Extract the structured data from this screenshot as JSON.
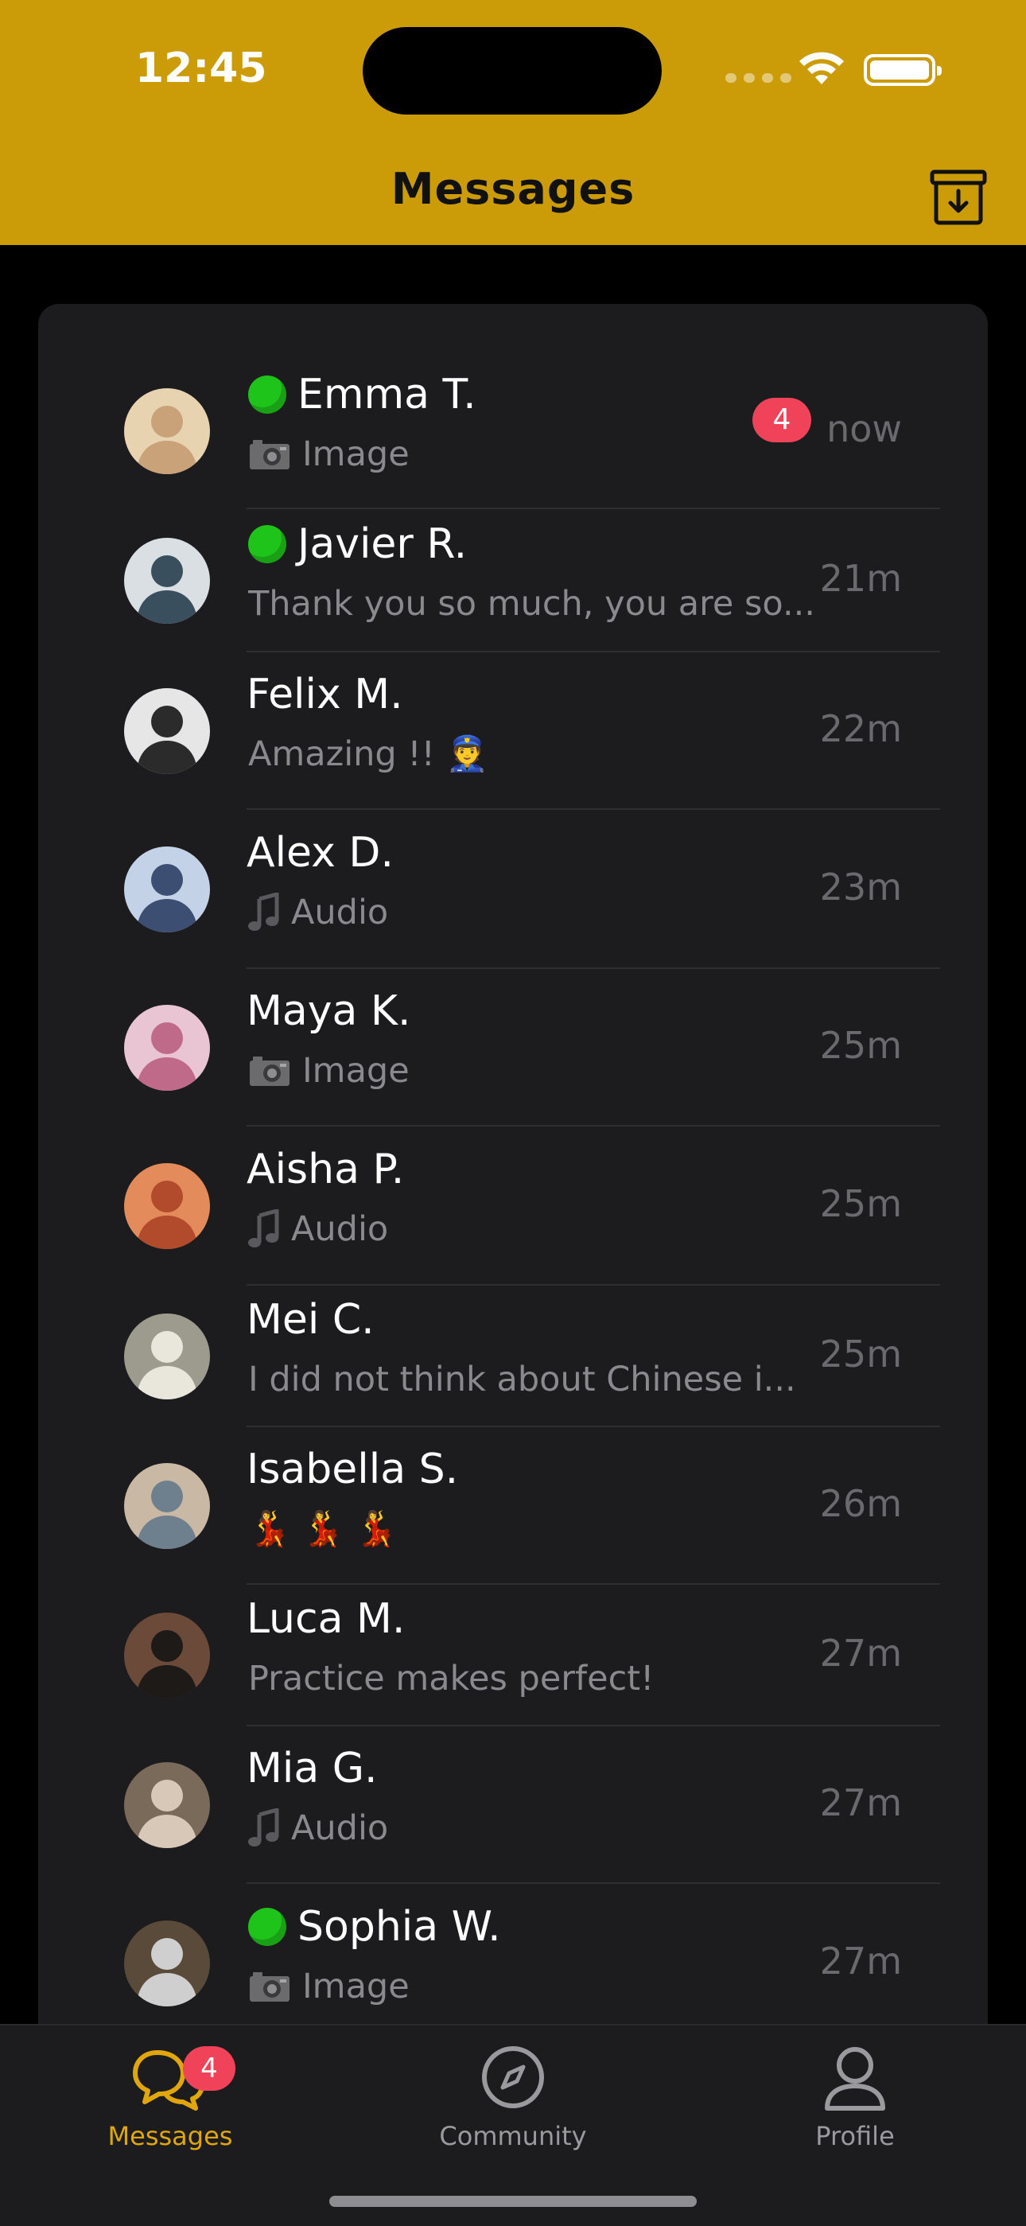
{
  "status_bar": {
    "time": "12:45"
  },
  "header": {
    "title": "Messages",
    "archive_icon": "archive-icon"
  },
  "colors": {
    "accent": "#CC9C08",
    "online": "#1fc41a",
    "badge": "#f0435a",
    "card": "#1c1c1e"
  },
  "conversations": [
    {
      "name": "Emma T.",
      "online": true,
      "preview_icon": "camera-icon",
      "preview": "Image",
      "time": "now",
      "unread": "4"
    },
    {
      "name": "Javier R.",
      "online": true,
      "preview_icon": "",
      "preview": "Thank you so much, you are so...",
      "time": "21m"
    },
    {
      "name": "Felix M.",
      "online": false,
      "preview_icon": "",
      "preview": "Amazing !! 👮",
      "time": "22m"
    },
    {
      "name": "Alex D.",
      "online": false,
      "preview_icon": "music-note-icon",
      "preview": "Audio",
      "time": "23m"
    },
    {
      "name": "Maya K.",
      "online": false,
      "preview_icon": "camera-icon",
      "preview": "Image",
      "time": "25m"
    },
    {
      "name": "Aisha P.",
      "online": false,
      "preview_icon": "music-note-icon",
      "preview": "Audio",
      "time": "25m"
    },
    {
      "name": "Mei C.",
      "online": false,
      "preview_icon": "",
      "preview": "I did not think about Chinese i...",
      "time": "25m"
    },
    {
      "name": "Isabella S.",
      "online": false,
      "preview_icon": "",
      "preview": "💃 💃 💃",
      "time": "26m"
    },
    {
      "name": "Luca M.",
      "online": false,
      "preview_icon": "",
      "preview": "Practice makes perfect!",
      "time": "27m"
    },
    {
      "name": "Mia G.",
      "online": false,
      "preview_icon": "music-note-icon",
      "preview": "Audio",
      "time": "27m"
    },
    {
      "name": "Sophia W.",
      "online": true,
      "preview_icon": "camera-icon",
      "preview": "Image",
      "time": "27m"
    }
  ],
  "tabbar": {
    "messages": {
      "label": "Messages",
      "badge": "4",
      "icon": "chat-bubbles-icon"
    },
    "community": {
      "label": "Community",
      "icon": "compass-icon"
    },
    "profile": {
      "label": "Profile",
      "icon": "person-icon"
    }
  }
}
